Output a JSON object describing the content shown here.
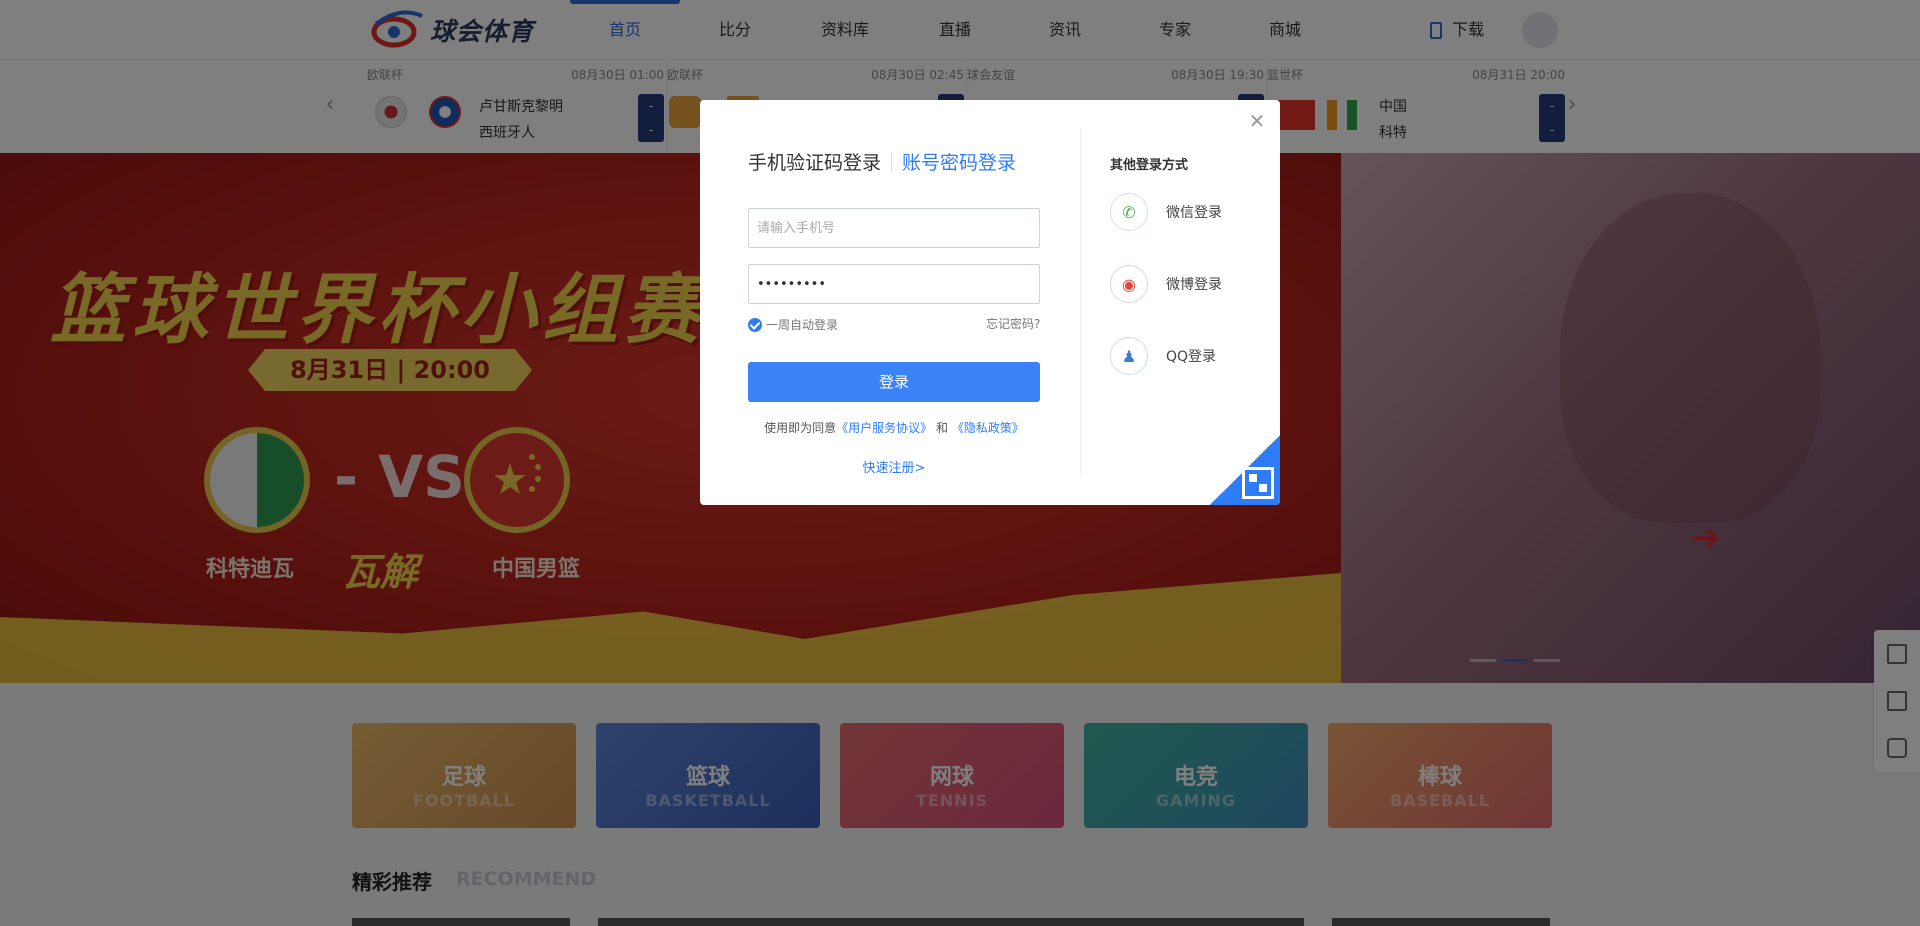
{
  "header": {
    "logo_text": "球会体育",
    "nav": [
      {
        "label": "首页",
        "active": true
      },
      {
        "label": "比分",
        "active": false
      },
      {
        "label": "资料库",
        "active": false
      },
      {
        "label": "直播",
        "active": false
      },
      {
        "label": "资讯",
        "active": false
      },
      {
        "label": "专家",
        "active": false
      },
      {
        "label": "商城",
        "active": false
      }
    ],
    "download_label": "下载"
  },
  "scores": {
    "prev_icon": "chevron-left-icon",
    "next_icon": "chevron-right-icon",
    "matches": [
      {
        "league": "欧联杯",
        "time": "08月30日 01:00",
        "home": "卢甘斯克黎明",
        "away": "西班牙人",
        "home_score": "-",
        "away_score": "-"
      },
      {
        "league": "欧联杯",
        "time": "08月30日 02:45",
        "home": "",
        "away": "",
        "home_score": "-",
        "away_score": "-"
      },
      {
        "league": "球会友谊",
        "time": "08月30日 19:30",
        "home": "",
        "away": "",
        "home_score": "-",
        "away_score": "-"
      },
      {
        "league": "篮世杯",
        "time": "08月31日 20:00",
        "home": "中国",
        "away": "科特",
        "home_score": "-",
        "away_score": "-"
      }
    ]
  },
  "banner": {
    "title": "篮球世界杯小组赛",
    "date": "8月31日  |  20:00",
    "vs": "- VS -",
    "team_left": "科特迪瓦",
    "team_right": "中国男篮",
    "tag": "瓦解"
  },
  "categories": [
    {
      "name": "足球",
      "en": "FOOTBALL",
      "color": "#d6a85e"
    },
    {
      "name": "篮球",
      "en": "BASKETBALL",
      "color": "#4c73c7"
    },
    {
      "name": "网球",
      "en": "TENNIS",
      "color": "#d75a6d"
    },
    {
      "name": "电竞",
      "en": "GAMING",
      "color": "#3f9aa7"
    },
    {
      "name": "棒球",
      "en": "BASEBALL",
      "color": "#de8a6a"
    }
  ],
  "recommend": {
    "title": "精彩推荐",
    "en": "RECOMMEND"
  },
  "side_tools": [
    "qr-code-icon",
    "tv-icon",
    "chat-icon"
  ],
  "modal": {
    "tab_sms": "手机验证码登录",
    "tab_password": "账号密码登录",
    "phone_placeholder": "请输入手机号",
    "password_value": "•••••••••",
    "remember_label": "一周自动登录",
    "forgot_label": "忘记密码?",
    "login_label": "登录",
    "agree_prefix": "使用即为同意",
    "agree_terms": "《用户服务协议》",
    "agree_and": "和",
    "agree_privacy": "《隐私政策》",
    "register_label": "快速注册>",
    "other_title": "其他登录方式",
    "social": [
      {
        "label": "微信登录",
        "icon": "wechat-icon",
        "color": "#4cb050"
      },
      {
        "label": "微博登录",
        "icon": "weibo-icon",
        "color": "#e2483d"
      },
      {
        "label": "QQ登录",
        "icon": "qq-icon",
        "color": "#3a7bd5"
      }
    ]
  }
}
